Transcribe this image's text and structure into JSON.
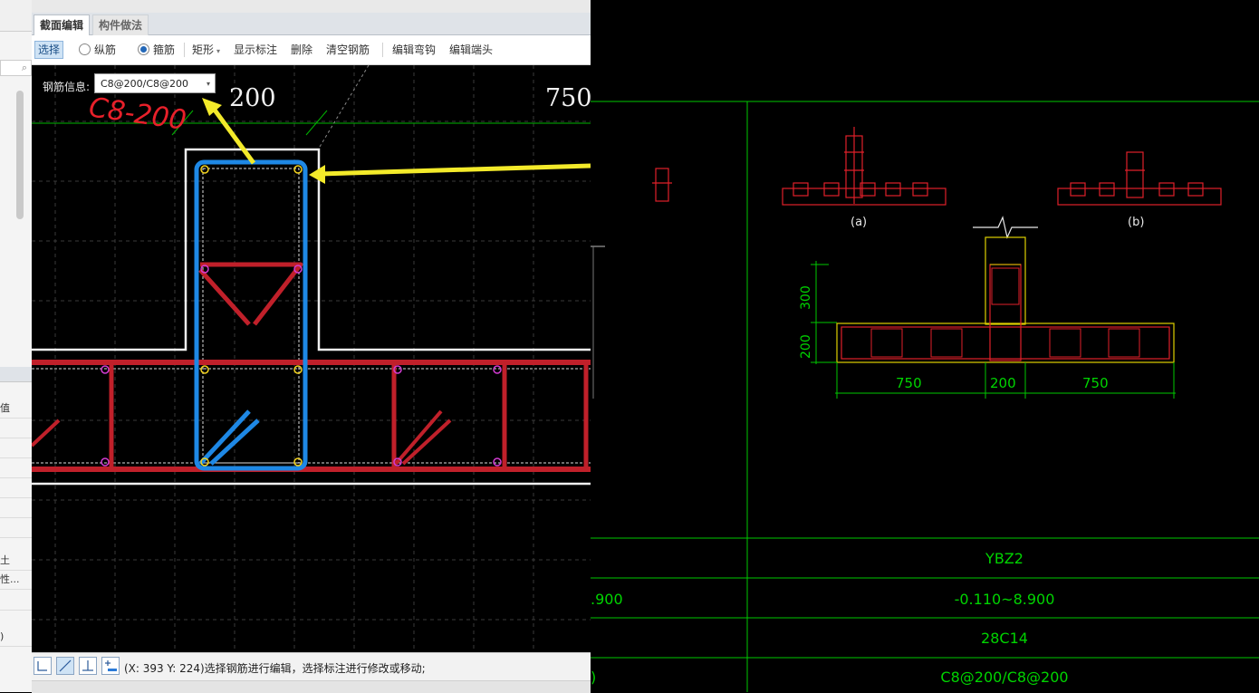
{
  "left_panel": {
    "rows": [
      "值",
      "土",
      "性...",
      ")"
    ]
  },
  "editor": {
    "tabs": [
      {
        "label": "截面编辑",
        "active": true
      },
      {
        "label": "构件做法",
        "active": false
      }
    ],
    "toolbar": {
      "select": "选择",
      "longitudinal": "纵筋",
      "stirrup": "箍筋",
      "rect": "矩形",
      "show_annot": "显示标注",
      "delete": "删除",
      "clear": "清空钢筋",
      "edit_hook": "编辑弯钩",
      "edit_end": "编辑端头"
    },
    "rebar_info_label": "钢筋信息:",
    "rebar_info_value": "C8@200/C8@200",
    "handwritten_note": "C8-200",
    "dim_200": "200",
    "dim_750": "750",
    "status": "(X: 393 Y: 224)选择钢筋进行编辑，选择标注进行修改或移动;"
  },
  "cad": {
    "label_a": "(a)",
    "label_b": "(b)",
    "dim_300": "300",
    "dim_200_v": "200",
    "dims_bottom": [
      "750",
      "200",
      "750"
    ],
    "table": [
      "YBZ2",
      "-0.110~8.900",
      "28C14",
      "C8@200/C8@200"
    ],
    "left_cut": [
      ".900",
      ")"
    ]
  },
  "colors": {
    "rebar_red": "#c0202a",
    "stirrup_blue": "#1e88e5",
    "cad_green": "#00d400",
    "cad_red": "#e0202a",
    "arrow_yellow": "#f3ea2a"
  }
}
